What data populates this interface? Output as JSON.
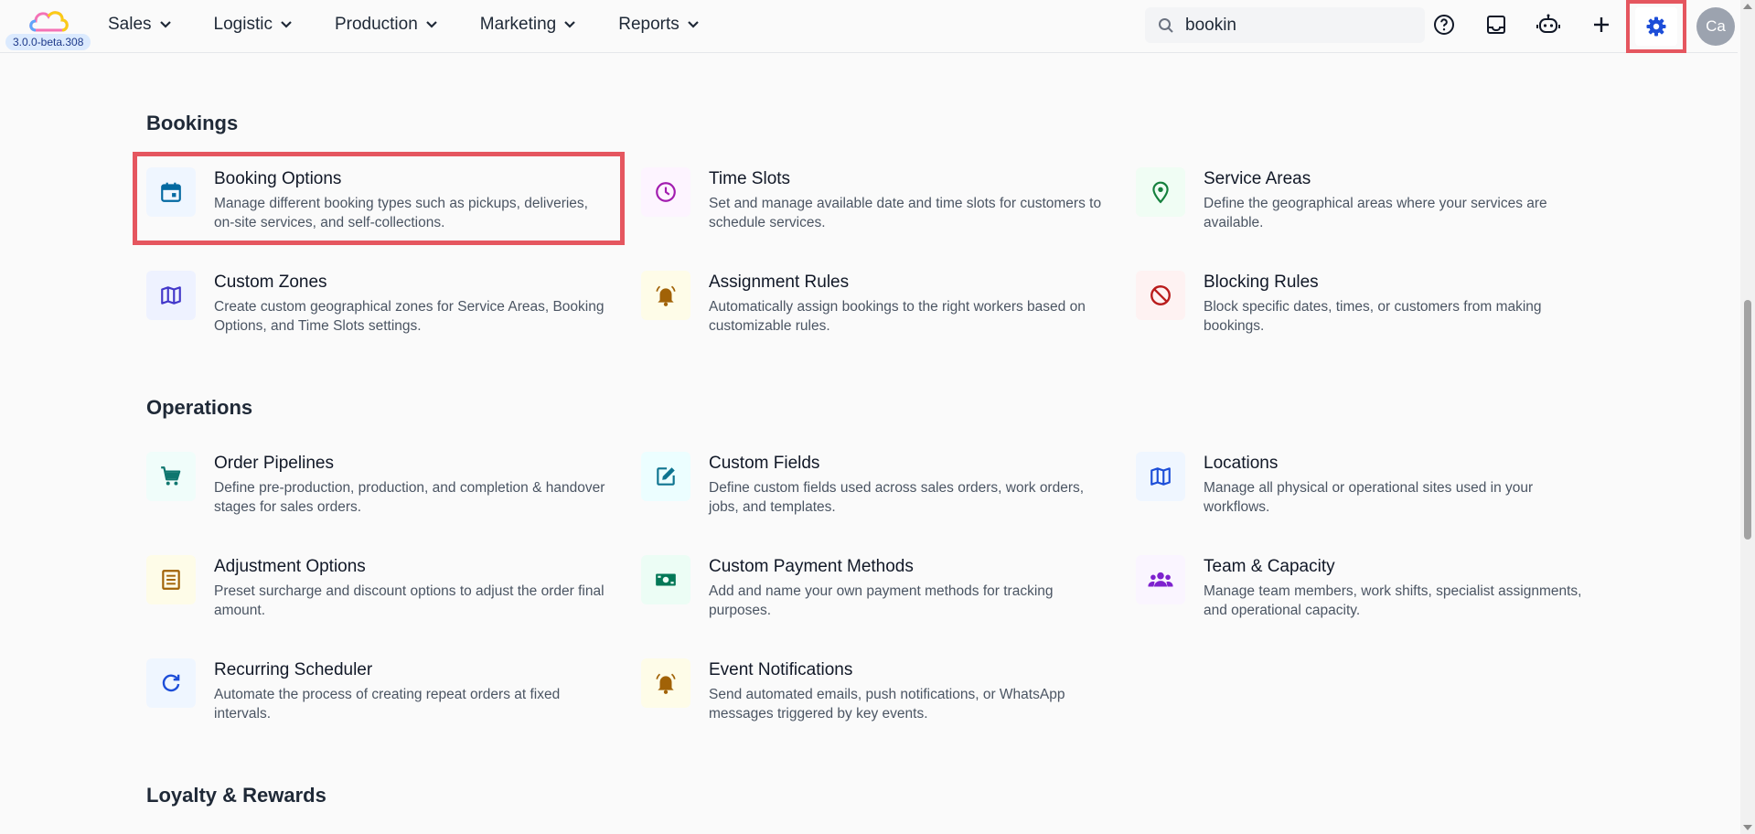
{
  "app": {
    "version": "3.0.0-beta.308"
  },
  "nav": [
    {
      "label": "Sales"
    },
    {
      "label": "Logistic"
    },
    {
      "label": "Production"
    },
    {
      "label": "Marketing"
    },
    {
      "label": "Reports"
    }
  ],
  "search": {
    "value": "bookin"
  },
  "user": {
    "initials": "Ca"
  },
  "icons": {
    "topbar": [
      "help-circle-icon",
      "inbox-icon",
      "robot-icon",
      "plus-icon",
      "gear-icon"
    ]
  },
  "sections": {
    "bookings": {
      "title": "Bookings",
      "cards": [
        {
          "title": "Booking Options",
          "desc": "Manage different booking types such as pickups, deliveries, on-site services, and self-collections.",
          "icon": "calendar-icon",
          "color": "#0369a1",
          "bg": "#eff6ff"
        },
        {
          "title": "Time Slots",
          "desc": "Set and manage available date and time slots for customers to schedule services.",
          "icon": "clock-icon",
          "color": "#a21caf",
          "bg": "#fdf4ff"
        },
        {
          "title": "Service Areas",
          "desc": "Define the geographical areas where your services are available.",
          "icon": "map-pin-icon",
          "color": "#15803d",
          "bg": "#f0fdf4"
        },
        {
          "title": "Custom Zones",
          "desc": "Create custom geographical zones for Service Areas, Booking Options, and Time Slots settings.",
          "icon": "map-icon",
          "color": "#4338ca",
          "bg": "#eef2ff"
        },
        {
          "title": "Assignment Rules",
          "desc": "Automatically assign bookings to the right workers based on customizable rules.",
          "icon": "bell-icon",
          "color": "#a16207",
          "bg": "#fefce8"
        },
        {
          "title": "Blocking Rules",
          "desc": "Block specific dates, times, or customers from making bookings.",
          "icon": "block-icon",
          "color": "#b91c1c",
          "bg": "#fef2f2"
        }
      ]
    },
    "operations": {
      "title": "Operations",
      "cards": [
        {
          "title": "Order Pipelines",
          "desc": "Define pre-production, production, and completion & handover stages for sales orders.",
          "icon": "cart-icon",
          "color": "#0f766e",
          "bg": "#f0fdfa"
        },
        {
          "title": "Custom Fields",
          "desc": "Define custom fields used across sales orders, work orders, jobs, and templates.",
          "icon": "edit-icon",
          "color": "#0e7490",
          "bg": "#ecfeff"
        },
        {
          "title": "Locations",
          "desc": "Manage all physical or operational sites used in your workflows.",
          "icon": "map-icon",
          "color": "#1d4ed8",
          "bg": "#eff6ff"
        },
        {
          "title": "Adjustment Options",
          "desc": "Preset surcharge and discount options to adjust the order final amount.",
          "icon": "receipt-icon",
          "color": "#a16207",
          "bg": "#fefce8"
        },
        {
          "title": "Custom Payment Methods",
          "desc": "Add and name your own payment methods for tracking purposes.",
          "icon": "cash-icon",
          "color": "#047857",
          "bg": "#ecfdf5"
        },
        {
          "title": "Team & Capacity",
          "desc": "Manage team members, work shifts, specialist assignments, and operational capacity.",
          "icon": "team-icon",
          "color": "#7e22ce",
          "bg": "#faf5ff"
        },
        {
          "title": "Recurring Scheduler",
          "desc": "Automate the process of creating repeat orders at fixed intervals.",
          "icon": "refresh-icon",
          "color": "#1d4ed8",
          "bg": "#eff6ff"
        },
        {
          "title": "Event Notifications",
          "desc": "Send automated emails, push notifications, or WhatsApp messages triggered by key events.",
          "icon": "bell-icon",
          "color": "#a16207",
          "bg": "#fefce8"
        }
      ]
    },
    "loyalty": {
      "title": "Loyalty & Rewards"
    }
  }
}
